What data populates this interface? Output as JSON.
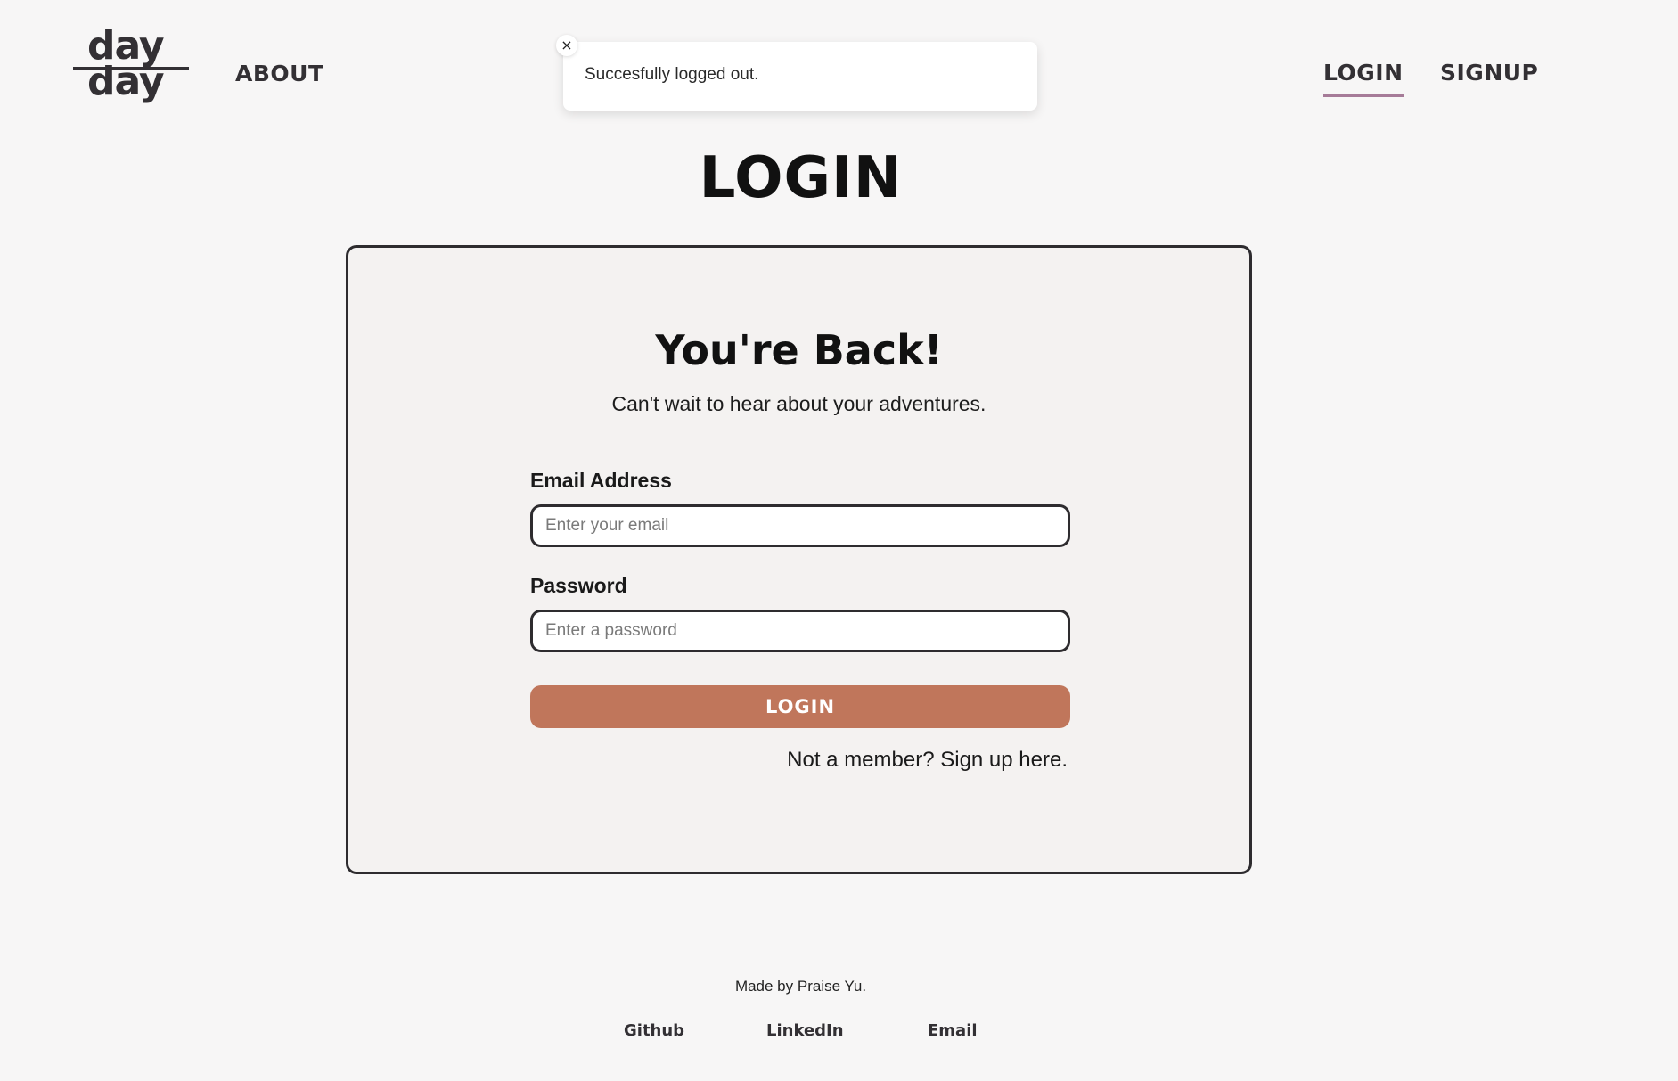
{
  "header": {
    "logo": {
      "line1": "day",
      "line2": "day"
    },
    "nav": {
      "about": "ABOUT",
      "login": "LOGIN",
      "signup": "SIGNUP"
    }
  },
  "toast": {
    "close_glyph": "×",
    "message": "Succesfully logged out."
  },
  "page": {
    "title": "LOGIN"
  },
  "card": {
    "title": "You're Back!",
    "subtitle": "Can't wait to hear about your adventures.",
    "email": {
      "label": "Email Address",
      "placeholder": "Enter your email",
      "value": ""
    },
    "password": {
      "label": "Password",
      "placeholder": "Enter a password",
      "value": ""
    },
    "submit_label": "LOGIN",
    "signup_text": "Not a member? Sign up here."
  },
  "footer": {
    "credit": "Made by Praise Yu.",
    "links": [
      "Github",
      "LinkedIn",
      "Email"
    ]
  },
  "colors": {
    "background": "#f7f6f6",
    "card_background": "#f4f2f1",
    "accent_button": "#c0765b",
    "active_nav_underline": "#a67b98",
    "text_dark": "#2e2c2f"
  },
  "icons": {
    "toast_close": "close-icon"
  }
}
